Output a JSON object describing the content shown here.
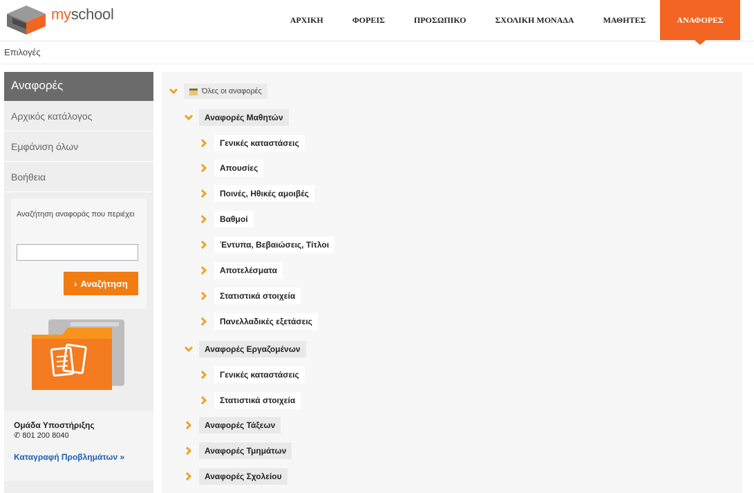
{
  "header": {
    "logo_my": "my",
    "logo_school": "school",
    "nav": [
      {
        "label": "ΑΡΧΙΚΗ"
      },
      {
        "label": "ΦΟΡΕΙΣ"
      },
      {
        "label": "ΠΡΟΣΩΠΙΚΟ"
      },
      {
        "label": "ΣΧΟΛΙΚΗ ΜΟΝΑΔΑ"
      },
      {
        "label": "ΜΑΘΗΤΕΣ"
      },
      {
        "label": "ΑΝΑΦΟΡΕΣ"
      }
    ]
  },
  "options_label": "Επιλογές",
  "sidebar": {
    "title": "Αναφορές",
    "links": [
      {
        "label": "Αρχικός κατάλογος"
      },
      {
        "label": "Εμφάνιση όλων"
      },
      {
        "label": "Βοήθεια"
      }
    ],
    "search": {
      "label": "Αναζήτηση αναφοράς που περιέχει",
      "value": "",
      "button_label": "Αναζήτηση"
    },
    "support": {
      "title": "Ομάδα Υποστήριξης",
      "phone": "801 200 8040",
      "link": "Καταγραφή Προβλημάτων »"
    }
  },
  "tree": {
    "root": "Όλες οι αναφορές",
    "groups": [
      {
        "label": "Αναφορές Μαθητών",
        "children": [
          {
            "label": "Γενικές καταστάσεις"
          },
          {
            "label": "Απουσίες"
          },
          {
            "label": "Ποινές, Ηθικές αμοιβές"
          },
          {
            "label": "Βαθμοί"
          },
          {
            "label": "Έντυπα, Βεβαιώσεις, Τίτλοι"
          },
          {
            "label": "Αποτελέσματα"
          },
          {
            "label": "Στατιστικά στοιχεία"
          },
          {
            "label": "Πανελλαδικές εξετάσεις"
          }
        ]
      },
      {
        "label": "Αναφορές Εργαζομένων",
        "children": [
          {
            "label": "Γενικές καταστάσεις"
          },
          {
            "label": "Στατιστικά στοιχεία"
          }
        ]
      },
      {
        "label": "Αναφορές Τάξεων"
      },
      {
        "label": "Αναφορές Τμημάτων"
      },
      {
        "label": "Αναφορές Σχολείου"
      }
    ]
  },
  "colors": {
    "accent": "#f26522",
    "button": "#f07c12",
    "chevron": "#f0a020",
    "link": "#1a5fb4"
  }
}
